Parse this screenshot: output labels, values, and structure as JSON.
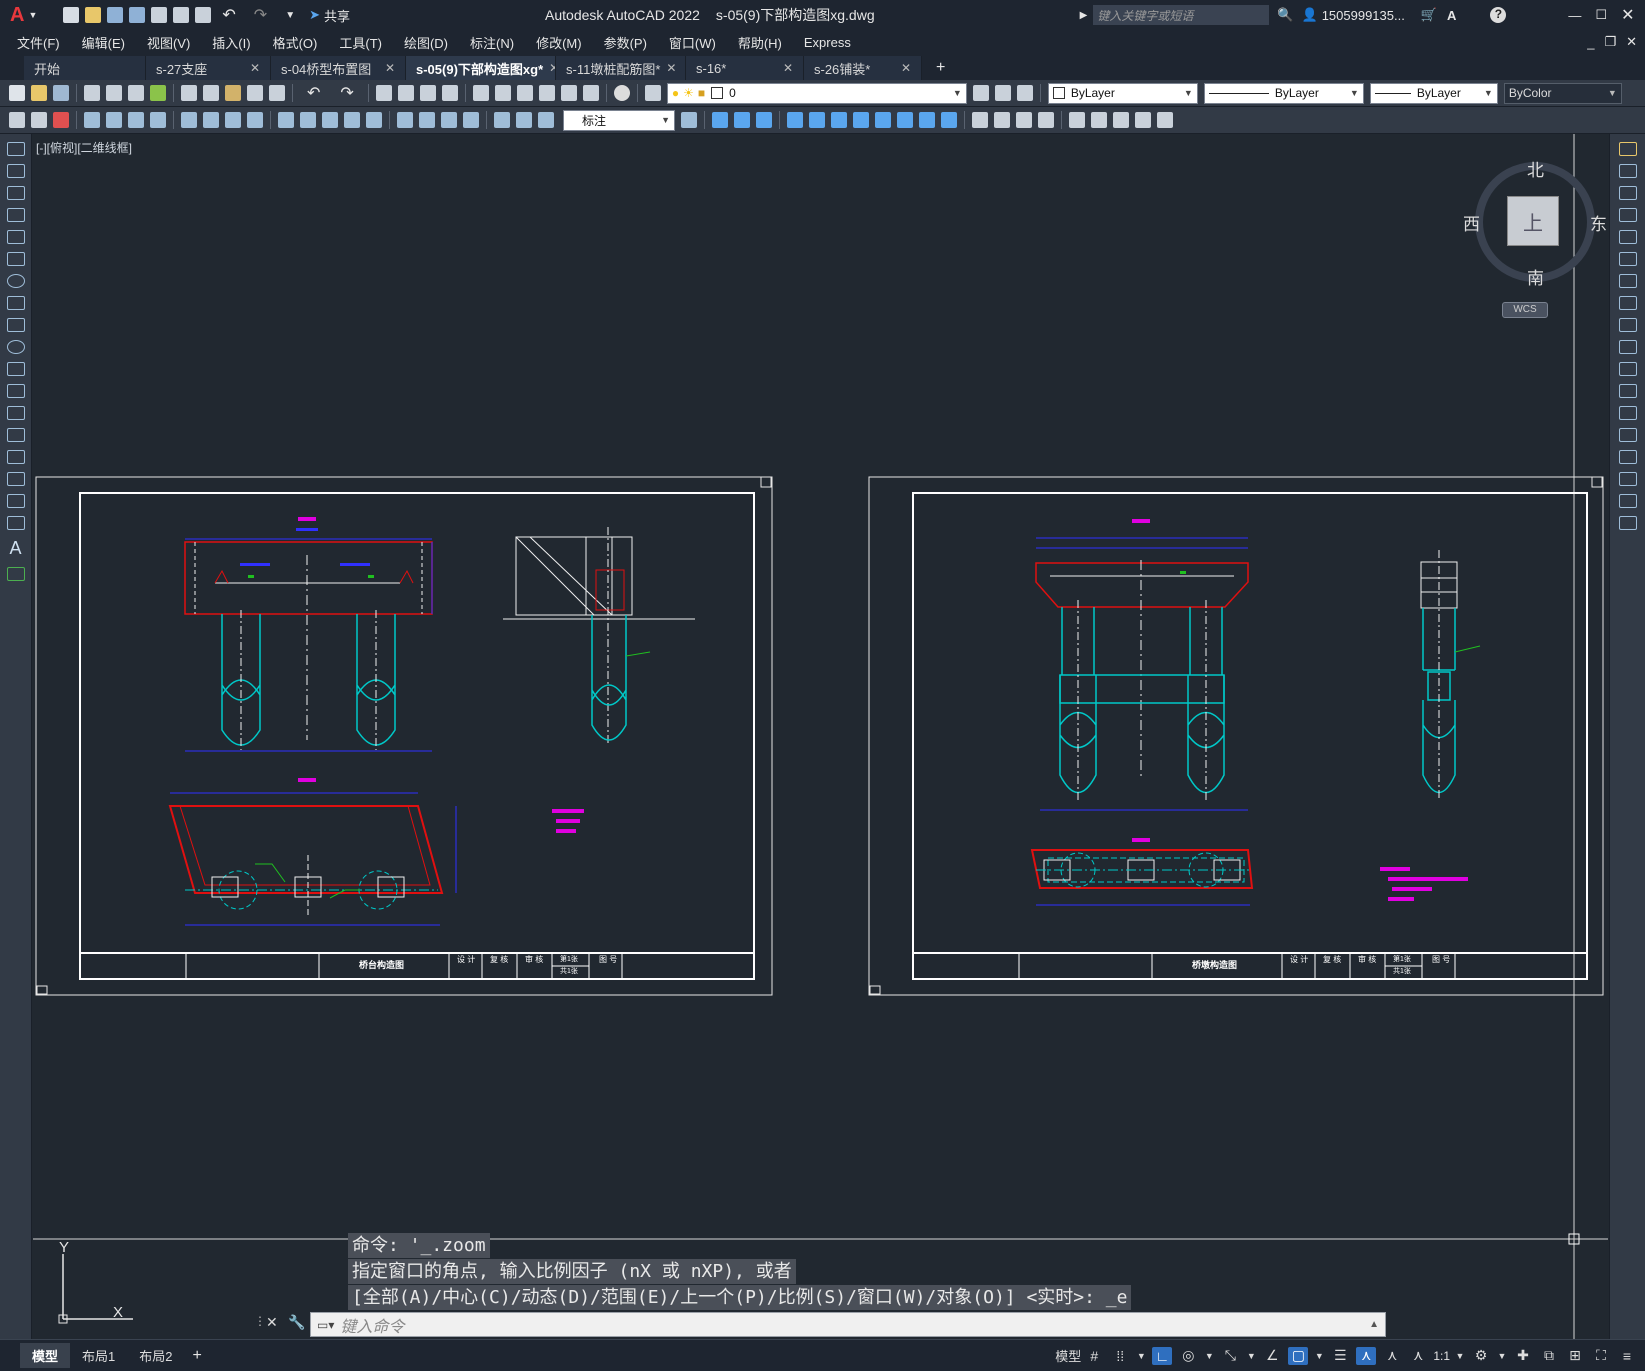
{
  "window": {
    "app_title": "Autodesk AutoCAD 2022",
    "file_title": "s-05(9)下部构造图xg.dwg",
    "app_letter": "A",
    "share_label": "共享",
    "search_placeholder": "键入关键字或短语",
    "user": "1505999135...",
    "help": "?"
  },
  "menu": [
    "文件(F)",
    "编辑(E)",
    "视图(V)",
    "插入(I)",
    "格式(O)",
    "工具(T)",
    "绘图(D)",
    "标注(N)",
    "修改(M)",
    "参数(P)",
    "窗口(W)",
    "帮助(H)",
    "Express"
  ],
  "tabs": [
    {
      "label": "开始",
      "close": ""
    },
    {
      "label": "s-27支座",
      "close": "✕"
    },
    {
      "label": "s-04桥型布置图",
      "close": "✕"
    },
    {
      "label": "s-05(9)下部构造图xg*",
      "close": "✕",
      "active": true
    },
    {
      "label": "s-11墩桩配筋图*",
      "close": "✕"
    },
    {
      "label": "s-16*",
      "close": "✕"
    },
    {
      "label": "s-26铺装*",
      "close": "✕"
    }
  ],
  "layer_combo": "0",
  "props": {
    "color": "ByLayer",
    "linetype": "ByLayer",
    "lineweight": "ByLayer",
    "plotstyle": "ByColor"
  },
  "dimstyle": "标注",
  "viewport_label": "[-][俯视][二维线框]",
  "viewcube": {
    "north": "北",
    "south": "南",
    "east": "东",
    "west": "西",
    "top": "上",
    "wcs": "WCS"
  },
  "drawings": [
    {
      "title": "桥台构造图",
      "cells": [
        "设 计",
        "复 核",
        "审 核",
        "第1张",
        "图 号",
        "共1张"
      ]
    },
    {
      "title": "桥墩构造图",
      "cells": [
        "设 计",
        "复 核",
        "审 核",
        "第1张",
        "图 号",
        "共1张"
      ]
    }
  ],
  "command": {
    "line1": "命令: '_.zoom",
    "line2": "指定窗口的角点, 输入比例因子 (nX 或 nXP), 或者",
    "line3": "[全部(A)/中心(C)/动态(D)/范围(E)/上一个(P)/比例(S)/窗口(W)/对象(O)] <实时>: _e",
    "placeholder": "键入命令"
  },
  "ucs": {
    "x": "X",
    "y": "Y"
  },
  "layout_tabs": [
    "模型",
    "布局1",
    "布局2"
  ],
  "status": {
    "model": "模型",
    "scale": "1:1"
  },
  "colors": {
    "bg": "#212830",
    "cyan": "#00c8c8",
    "red": "#e01010",
    "magenta": "#e000e0",
    "blue": "#3030ff",
    "green": "#20c020",
    "white": "#f0f0f0"
  }
}
